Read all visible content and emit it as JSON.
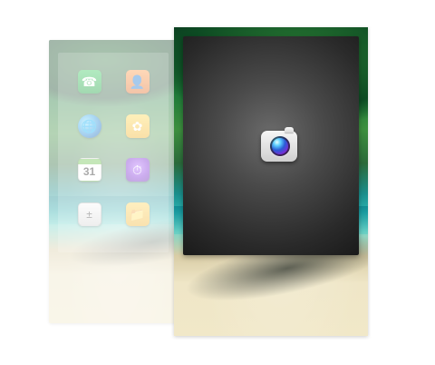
{
  "screen": {
    "background_color": "#ffffff",
    "apps": [
      {
        "name": "phone",
        "icon": "phone-icon"
      },
      {
        "name": "contacts",
        "icon": "contacts-icon"
      },
      {
        "name": "browser",
        "icon": "browser-globe-icon"
      },
      {
        "name": "gallery",
        "icon": "gallery-icon"
      },
      {
        "name": "calendar",
        "icon": "calendar-icon",
        "day": "31"
      },
      {
        "name": "clock",
        "icon": "clock-icon"
      },
      {
        "name": "calculator",
        "icon": "calculator-icon"
      },
      {
        "name": "my_files",
        "icon": "folder-icon"
      }
    ],
    "active_app": {
      "name": "camera",
      "icon": "camera-icon"
    },
    "colors": {
      "camera_panel_dark": "#1a1a1a",
      "water_teal": "#2ab5b2",
      "sand": "#efe6c7",
      "foliage_green": "#1f7a38"
    }
  }
}
